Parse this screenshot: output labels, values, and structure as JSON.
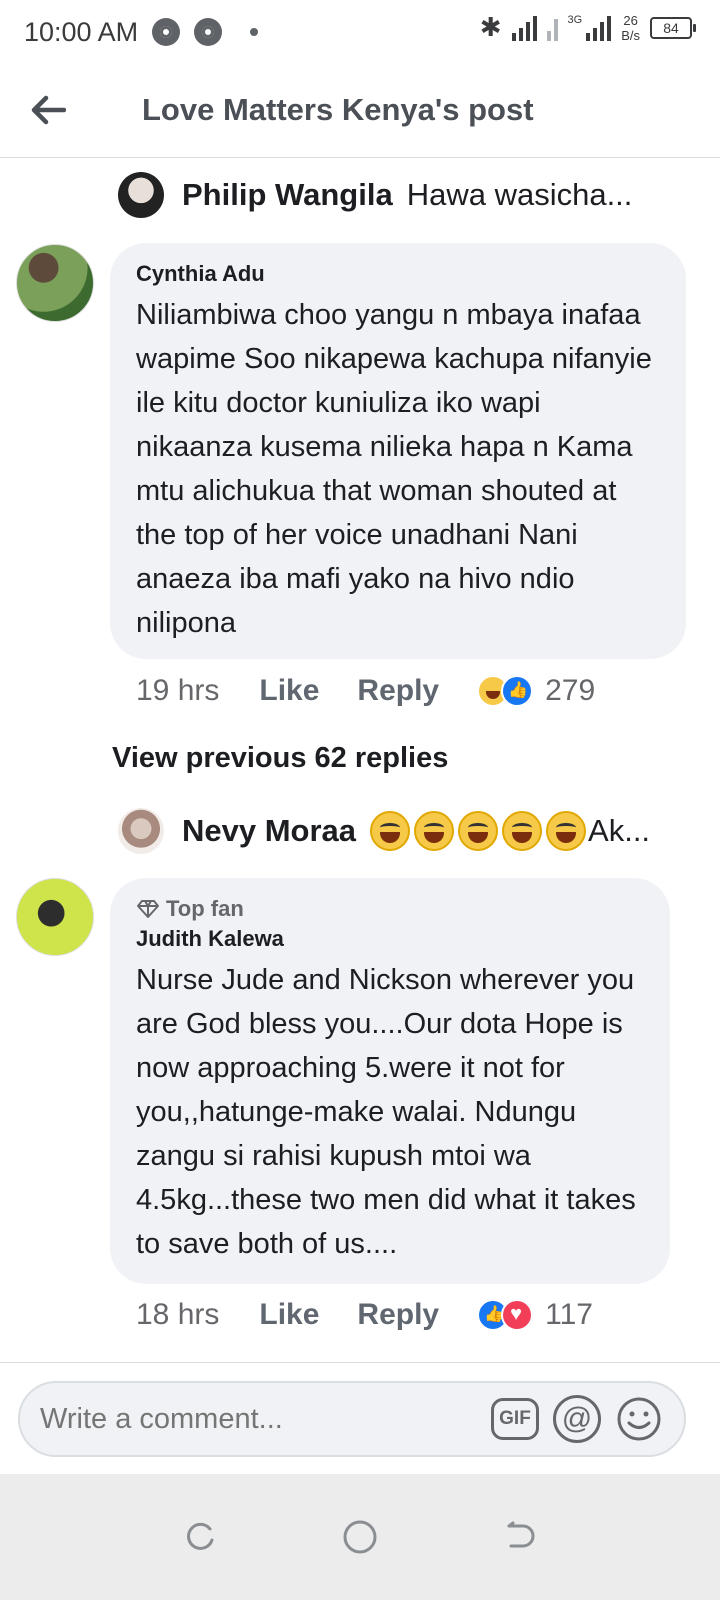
{
  "status_bar": {
    "time": "10:00 AM",
    "network": "3G",
    "rate_value": "26",
    "rate_unit": "B/s",
    "battery": "84"
  },
  "header": {
    "title": "Love Matters Kenya's post"
  },
  "reply_preview_1": {
    "name": "Philip Wangila",
    "text": "Hawa wasicha..."
  },
  "comment_1": {
    "name": "Cynthia Adu",
    "text": "Niliambiwa choo yangu n mbaya inafaa wapime Soo nikapewa kachupa nifanyie ile kitu doctor kuniuliza iko wapi nikaanza kusema nilieka hapa n Kama mtu alichukua that woman shouted at the top of her voice unadhani Nani anaeza iba mafi yako na hivo ndio nilipona",
    "time": "19 hrs",
    "like_label": "Like",
    "reply_label": "Reply",
    "reaction_count": "279"
  },
  "view_previous": "View previous 62 replies",
  "reply_preview_2": {
    "name": "Nevy Moraa",
    "text": "Ak..."
  },
  "comment_2": {
    "badge": "Top fan",
    "name": "Judith Kalewa",
    "text": "Nurse Jude and Nickson wherever you are God bless you....Our dota Hope is now approaching 5.were it not for you,,hatunge-make walai. Ndungu zangu si rahisi kupush mtoi wa 4.5kg...these two men did what it takes to save both of us....",
    "time": "18 hrs",
    "like_label": "Like",
    "reply_label": "Reply",
    "reaction_count": "117"
  },
  "composer": {
    "placeholder": "Write a comment...",
    "gif_label": "GIF",
    "at_label": "@"
  }
}
